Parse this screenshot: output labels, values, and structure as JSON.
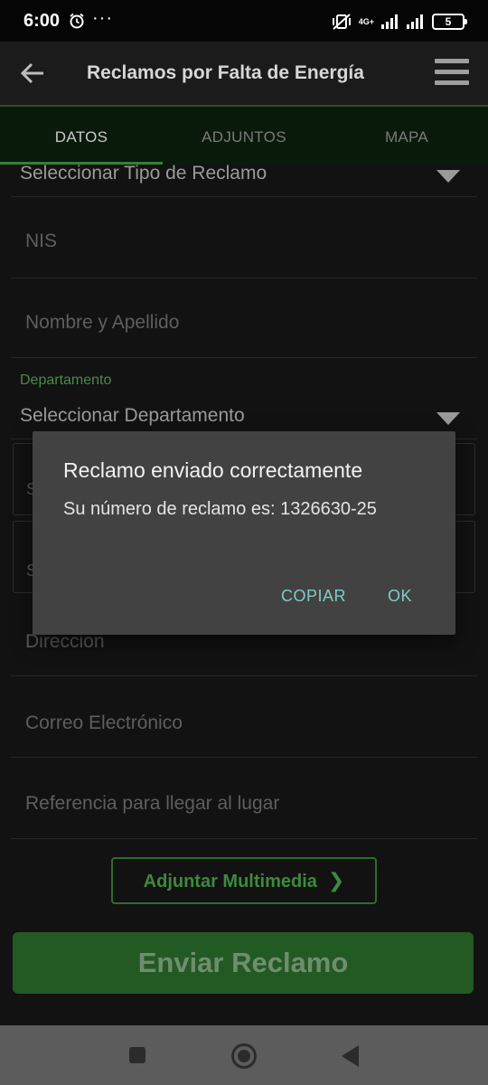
{
  "status_bar": {
    "time": "6:00",
    "more": "···",
    "network": "4G+",
    "battery": "5"
  },
  "app_bar": {
    "title": "Reclamos por Falta de Energía"
  },
  "tabs": [
    {
      "label": "DATOS",
      "active": true
    },
    {
      "label": "ADJUNTOS",
      "active": false
    },
    {
      "label": "MAPA",
      "active": false
    }
  ],
  "form": {
    "tipo_reclamo": "Seleccionar Tipo de Reclamo",
    "nis_placeholder": "NIS",
    "nombre_placeholder": "Nombre y Apellido",
    "departamento_label": "Departamento",
    "departamento_value": "Seleccionar Departamento",
    "box1_partial": "S",
    "box2_partial": "S",
    "direccion_placeholder": "Direccion",
    "correo_placeholder": "Correo Electrónico",
    "referencia_placeholder": "Referencia para llegar al lugar"
  },
  "buttons": {
    "adjuntar": "Adjuntar Multimedia",
    "enviar": "Enviar Reclamo"
  },
  "dialog": {
    "title": "Reclamo enviado correctamente",
    "message": "Su número de reclamo es: 1326630-25",
    "copy_label": "COPIAR",
    "ok_label": "OK"
  },
  "colors": {
    "accent_green": "#3d8a3d",
    "dialog_button": "#80cbc4",
    "dialog_bg": "#424242"
  }
}
